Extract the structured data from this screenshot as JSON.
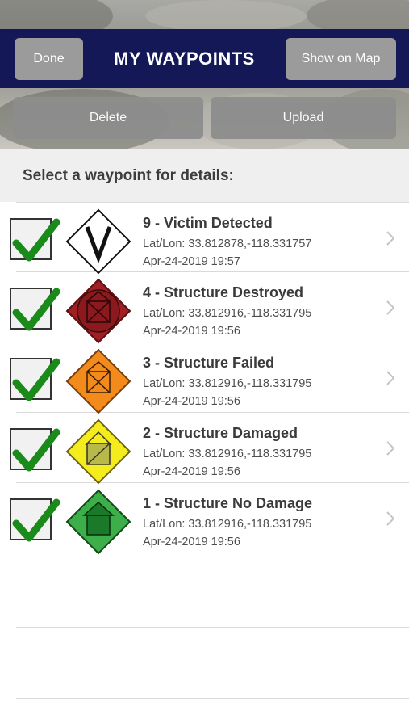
{
  "header": {
    "done_label": "Done",
    "title": "MY WAYPOINTS",
    "show_map_label": "Show on Map"
  },
  "actions": {
    "delete_label": "Delete",
    "upload_label": "Upload"
  },
  "section_header": "Select a waypoint for details:",
  "colors": {
    "nav_bar": "#151856",
    "button_gray": "#9b9b9b",
    "check_green": "#1a8a1a"
  },
  "waypoints": [
    {
      "title": "9 - Victim Detected",
      "latlon": "Lat/Lon: 33.812878,-118.331757",
      "timestamp": "Apr-24-2019 19:57",
      "icon": "victim-detected-icon",
      "checked": true
    },
    {
      "title": "4 - Structure Destroyed",
      "latlon": "Lat/Lon: 33.812916,-118.331795",
      "timestamp": "Apr-24-2019 19:56",
      "icon": "structure-destroyed-icon",
      "checked": true
    },
    {
      "title": "3 - Structure Failed",
      "latlon": "Lat/Lon: 33.812916,-118.331795",
      "timestamp": "Apr-24-2019 19:56",
      "icon": "structure-failed-icon",
      "checked": true
    },
    {
      "title": "2 - Structure Damaged",
      "latlon": "Lat/Lon: 33.812916,-118.331795",
      "timestamp": "Apr-24-2019 19:56",
      "icon": "structure-damaged-icon",
      "checked": true
    },
    {
      "title": "1 - Structure No Damage",
      "latlon": "Lat/Lon: 33.812916,-118.331795",
      "timestamp": "Apr-24-2019 19:56",
      "icon": "structure-no-damage-icon",
      "checked": true
    }
  ]
}
